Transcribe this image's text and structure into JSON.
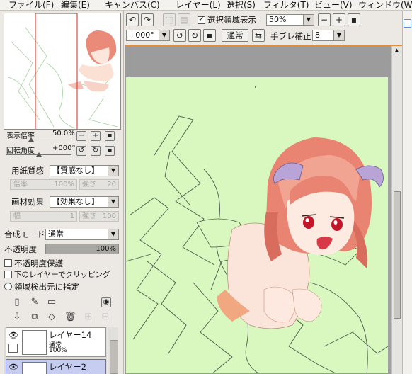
{
  "menu": [
    "ファイル(F)",
    "編集(E)",
    "キャンバス(C)",
    "レイヤー(L)",
    "選択(S)",
    "フィルタ(T)",
    "ビュー(V)",
    "ウィンドウ(W)"
  ],
  "navigator": {
    "zoom_label": "表示倍率",
    "zoom_value": "50.0%",
    "rotation_label": "回転角度",
    "rotation_value": "+000°"
  },
  "paper": {
    "texture_label": "用紙質感",
    "texture_value": "【質感なし】",
    "scale_label": "倍率",
    "scale_value": "100%",
    "strength_label": "強さ",
    "strength_value": "20"
  },
  "effect": {
    "label": "画材効果",
    "value": "【効果なし】",
    "width_label": "幅",
    "width_value": "1",
    "strength_label": "強さ",
    "strength_value": "100"
  },
  "blend": {
    "label": "合成モード",
    "value": "通常",
    "opacity_label": "不透明度",
    "opacity_value": "100%",
    "opacity_fraction": 1.0
  },
  "options": {
    "lock_opacity": "不透明度保護",
    "clip_lower": "下のレイヤーでクリッピング",
    "selection_source": "領域検出元に指定"
  },
  "layers": [
    {
      "name": "レイヤー14",
      "mode": "通常",
      "opacity": "100%"
    },
    {
      "name": "レイヤー2",
      "mode": "",
      "opacity": ""
    }
  ],
  "toolbar": {
    "show_selection_label": "選択領域表示",
    "show_selection_checked": true,
    "zoom_value": "50%",
    "rotation_value": "+000°",
    "flip_label": "通常",
    "stabilizer_label": "手ブレ補正",
    "stabilizer_value": "8"
  },
  "colors": {
    "canvas_bg": "#d8f8bf",
    "accent_border": "#e08b38"
  }
}
